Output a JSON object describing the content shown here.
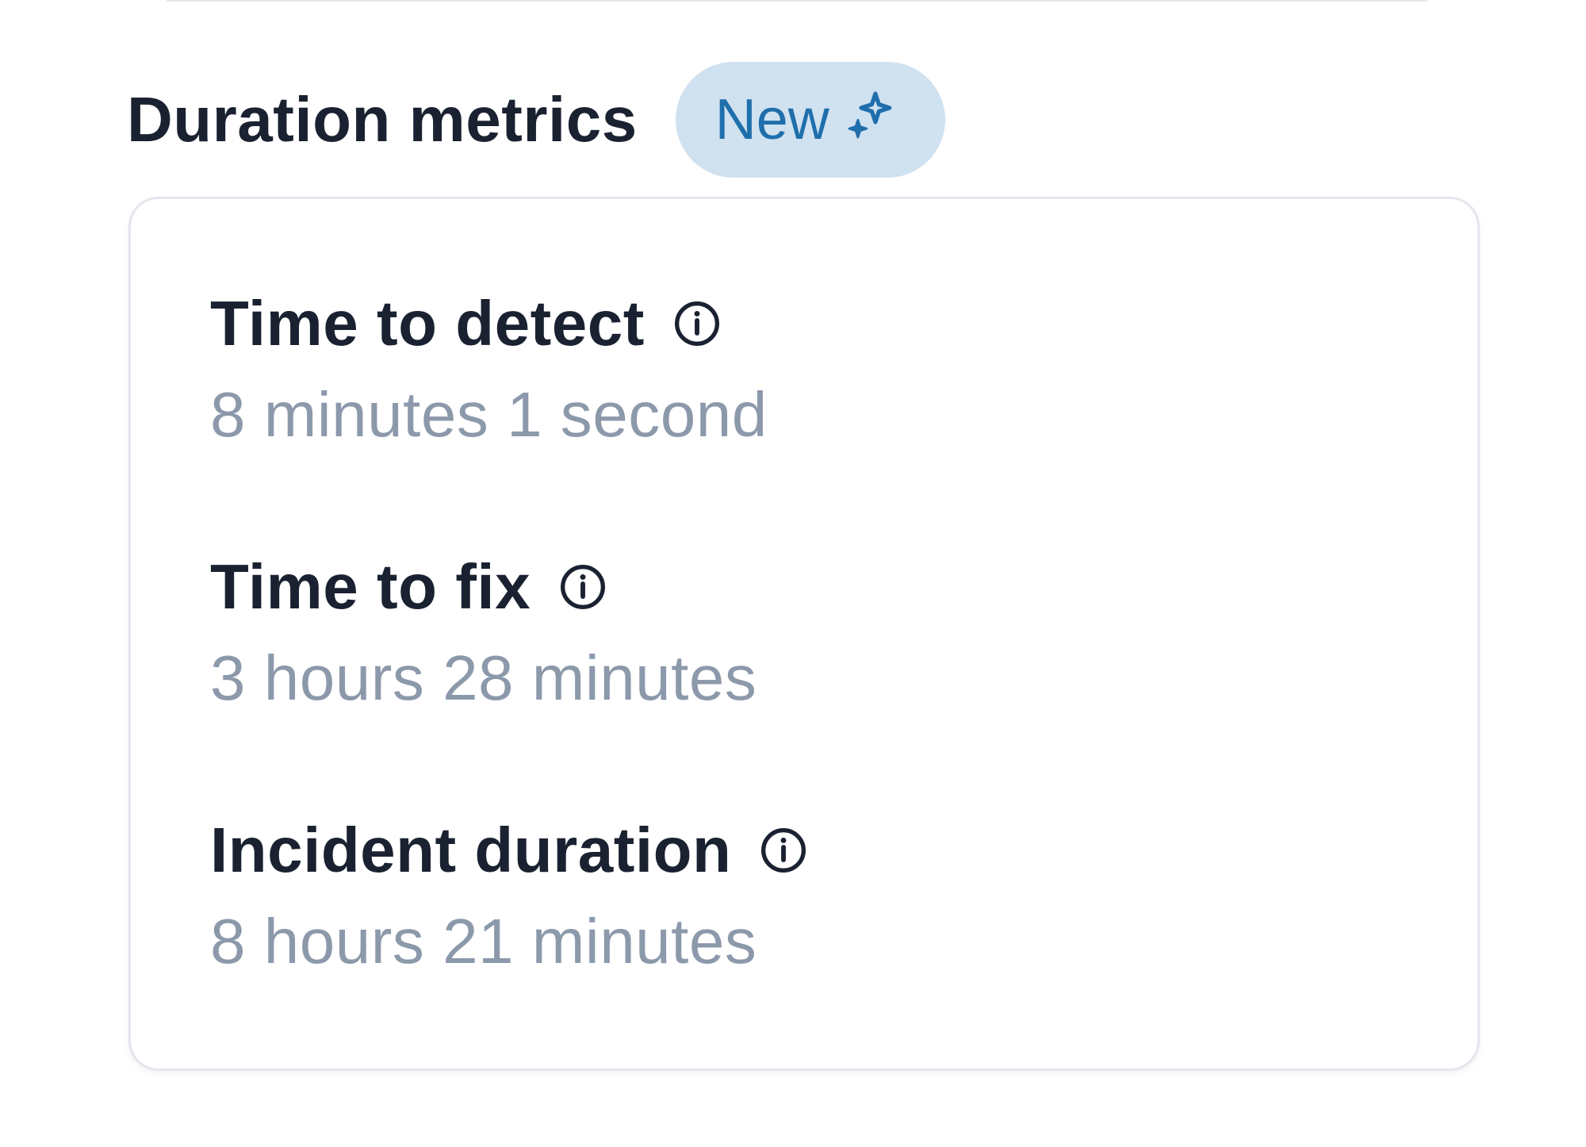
{
  "section": {
    "title": "Duration metrics",
    "badge_label": "New",
    "badge_icon": "sparkle-icon"
  },
  "colors": {
    "title_text": "#1a2231",
    "value_text": "#8c99ab",
    "badge_bg": "#d0e1f0",
    "badge_text": "#1f6fac",
    "card_border": "#e3e6ec"
  },
  "metrics": [
    {
      "label": "Time to detect",
      "value": "8 minutes 1 second",
      "icon": "info-icon"
    },
    {
      "label": "Time to fix",
      "value": "3 hours 28 minutes",
      "icon": "info-icon"
    },
    {
      "label": "Incident duration",
      "value": "8 hours 21 minutes",
      "icon": "info-icon"
    }
  ]
}
